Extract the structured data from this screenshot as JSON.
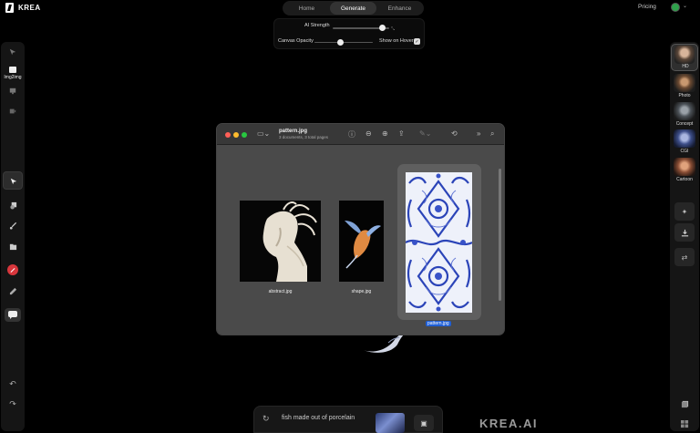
{
  "app": {
    "brand": "KREA"
  },
  "nav": {
    "tabs": [
      {
        "label": "Home"
      },
      {
        "label": "Generate"
      },
      {
        "label": "Enhance"
      }
    ]
  },
  "header": {
    "pricing": "Pricing"
  },
  "settings": {
    "ai_strength_label": "AI Strength",
    "ai_strength_value": 0.88,
    "canvas_opacity_label": "Canvas Opacity",
    "canvas_opacity_value": 0.45,
    "show_on_hover_label": "Show on Hover",
    "show_on_hover_checked": true
  },
  "left_sidebar": {
    "items": [
      {
        "icon": "cursor-icon"
      },
      {
        "icon": "image-icon",
        "label": "Img2img"
      },
      {
        "icon": "monitor-icon"
      },
      {
        "icon": "video-icon"
      },
      {
        "icon": "select-arrow-icon"
      },
      {
        "icon": "shapes-icon"
      },
      {
        "icon": "brush-icon"
      },
      {
        "icon": "folder-icon"
      },
      {
        "icon": "eraser-red-icon"
      },
      {
        "icon": "eyedropper-icon"
      },
      {
        "icon": "chat-icon"
      },
      {
        "icon": "undo-icon"
      },
      {
        "icon": "redo-icon"
      }
    ]
  },
  "right_sidebar": {
    "styles": [
      {
        "label": "HD"
      },
      {
        "label": "Photo"
      },
      {
        "label": "Concept"
      },
      {
        "label": "CGI"
      },
      {
        "label": "Cartoon"
      }
    ],
    "tools": [
      {
        "icon": "sparkle-icon"
      },
      {
        "icon": "download-icon"
      },
      {
        "icon": "shuffle-icon"
      }
    ]
  },
  "preview_window": {
    "title": "pattern.jpg",
    "subtitle": "3 documents, 3 total pages",
    "files": [
      {
        "name": "abstract.jpg"
      },
      {
        "name": "shape.jpg"
      },
      {
        "name": "pattern.jpg"
      }
    ]
  },
  "prompt": {
    "text": "fish made out of porcelain"
  },
  "watermark": "KREA.AI",
  "colors": {
    "accent_selection": "#1f5fd6",
    "red_tool": "#d8363c",
    "avatar": "#2fa14b"
  }
}
